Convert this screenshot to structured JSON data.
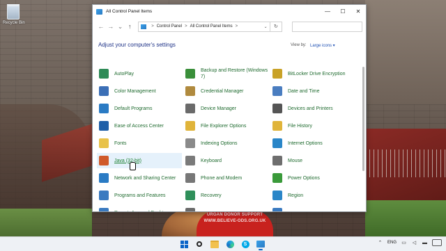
{
  "desktop": {
    "recycle_bin_label": "Recycle Bin",
    "wallpaper_text": [
      "URGAN DONOR SUPPORT",
      "WWW.BELIEVE-ODS.ORG.UK"
    ]
  },
  "window": {
    "title": "All Control Panel Items",
    "controls": {
      "minimize": "—",
      "maximize": "☐",
      "close": "✕"
    },
    "nav": {
      "back": "←",
      "forward": "→",
      "recent": "⌄",
      "up": "↑"
    },
    "address": {
      "crumbs": [
        "Control Panel",
        "All Control Panel Items"
      ],
      "separator": ">",
      "dropdown": "⌄",
      "refresh": "↻"
    },
    "search_placeholder": "",
    "heading": "Adjust your computer's settings",
    "view_by_label": "View by:",
    "view_by_value": "Large icons ▾"
  },
  "items": [
    {
      "label": "AutoPlay",
      "icon": "autoplay-icon",
      "color": "#2e8b57"
    },
    {
      "label": "Backup and Restore (Windows 7)",
      "icon": "backup-restore-icon",
      "color": "#3a8f3a"
    },
    {
      "label": "BitLocker Drive Encryption",
      "icon": "bitlocker-icon",
      "color": "#c9a227"
    },
    {
      "label": "Color Management",
      "icon": "color-management-icon",
      "color": "#3b6fb6"
    },
    {
      "label": "Credential Manager",
      "icon": "credential-manager-icon",
      "color": "#b08a3e"
    },
    {
      "label": "Date and Time",
      "icon": "date-time-icon",
      "color": "#4a7dc0"
    },
    {
      "label": "Default Programs",
      "icon": "default-programs-icon",
      "color": "#2a7bc4"
    },
    {
      "label": "Device Manager",
      "icon": "device-manager-icon",
      "color": "#6a6a6a"
    },
    {
      "label": "Devices and Printers",
      "icon": "devices-printers-icon",
      "color": "#555555"
    },
    {
      "label": "Ease of Access Center",
      "icon": "ease-of-access-icon",
      "color": "#1f5fa8"
    },
    {
      "label": "File Explorer Options",
      "icon": "file-explorer-options-icon",
      "color": "#e0b43a"
    },
    {
      "label": "File History",
      "icon": "file-history-icon",
      "color": "#e0b43a"
    },
    {
      "label": "Fonts",
      "icon": "fonts-icon",
      "color": "#e8c24a"
    },
    {
      "label": "Indexing Options",
      "icon": "indexing-options-icon",
      "color": "#8a8a8a"
    },
    {
      "label": "Internet Options",
      "icon": "internet-options-icon",
      "color": "#2a86c8"
    },
    {
      "label": "Java (32-bit)",
      "icon": "java-icon",
      "color": "#d05a2a"
    },
    {
      "label": "Keyboard",
      "icon": "keyboard-icon",
      "color": "#7a7a7a"
    },
    {
      "label": "Mouse",
      "icon": "mouse-icon",
      "color": "#6e6e6e"
    },
    {
      "label": "Network and Sharing Center",
      "icon": "network-sharing-icon",
      "color": "#2a7bc4"
    },
    {
      "label": "Phone and Modem",
      "icon": "phone-modem-icon",
      "color": "#777777"
    },
    {
      "label": "Power Options",
      "icon": "power-options-icon",
      "color": "#3a9a3a"
    },
    {
      "label": "Programs and Features",
      "icon": "programs-features-icon",
      "color": "#3a7ac0"
    },
    {
      "label": "Recovery",
      "icon": "recovery-icon",
      "color": "#2f8f5a"
    },
    {
      "label": "Region",
      "icon": "region-icon",
      "color": "#2a86c8"
    },
    {
      "label": "RemoteApp and Desktop",
      "icon": "remoteapp-icon",
      "color": "#3a7ac0"
    },
    {
      "label": "",
      "icon": "partial-item-icon",
      "color": "#6a6a6a"
    },
    {
      "label": "",
      "icon": "partial-item-icon",
      "color": "#3a7ac0"
    }
  ],
  "hovered_item": "Java (32-bit)",
  "taskbar": {
    "apps": [
      {
        "icon": "windows-start-icon"
      },
      {
        "icon": "search-icon"
      },
      {
        "icon": "file-explorer-icon"
      },
      {
        "icon": "edge-browser-icon"
      },
      {
        "icon": "skype-icon"
      },
      {
        "icon": "control-panel-icon",
        "active": true
      }
    ],
    "language": "ENG"
  },
  "colors": {
    "accent": "#0a64c8",
    "link_green": "#1e6a2e",
    "heading_blue": "#1e3287"
  }
}
